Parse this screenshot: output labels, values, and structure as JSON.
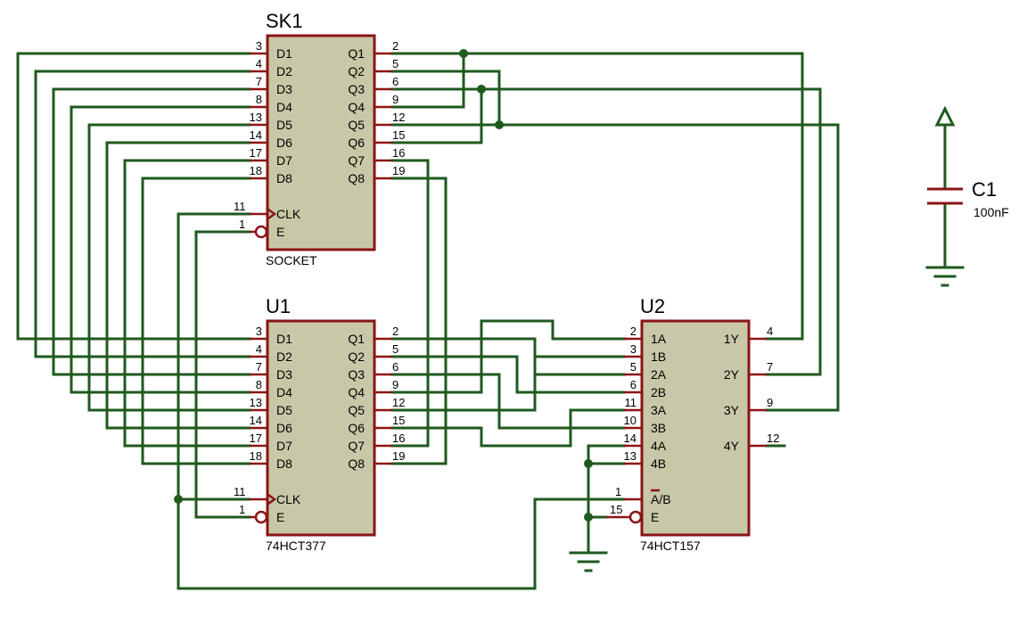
{
  "components": {
    "sk1": {
      "ref": "SK1",
      "value": "SOCKET",
      "left_pins": [
        {
          "num": "3",
          "label": "D1"
        },
        {
          "num": "4",
          "label": "D2"
        },
        {
          "num": "7",
          "label": "D3"
        },
        {
          "num": "8",
          "label": "D4"
        },
        {
          "num": "13",
          "label": "D5"
        },
        {
          "num": "14",
          "label": "D6"
        },
        {
          "num": "17",
          "label": "D7"
        },
        {
          "num": "18",
          "label": "D8"
        }
      ],
      "right_pins": [
        {
          "num": "2",
          "label": "Q1"
        },
        {
          "num": "5",
          "label": "Q2"
        },
        {
          "num": "6",
          "label": "Q3"
        },
        {
          "num": "9",
          "label": "Q4"
        },
        {
          "num": "12",
          "label": "Q5"
        },
        {
          "num": "15",
          "label": "Q6"
        },
        {
          "num": "16",
          "label": "Q7"
        },
        {
          "num": "19",
          "label": "Q8"
        }
      ],
      "clk": {
        "num": "11",
        "label": "CLK"
      },
      "en": {
        "num": "1",
        "label": "E"
      }
    },
    "u1": {
      "ref": "U1",
      "value": "74HCT377",
      "left_pins": [
        {
          "num": "3",
          "label": "D1"
        },
        {
          "num": "4",
          "label": "D2"
        },
        {
          "num": "7",
          "label": "D3"
        },
        {
          "num": "8",
          "label": "D4"
        },
        {
          "num": "13",
          "label": "D5"
        },
        {
          "num": "14",
          "label": "D6"
        },
        {
          "num": "17",
          "label": "D7"
        },
        {
          "num": "18",
          "label": "D8"
        }
      ],
      "right_pins": [
        {
          "num": "2",
          "label": "Q1"
        },
        {
          "num": "5",
          "label": "Q2"
        },
        {
          "num": "6",
          "label": "Q3"
        },
        {
          "num": "9",
          "label": "Q4"
        },
        {
          "num": "12",
          "label": "Q5"
        },
        {
          "num": "15",
          "label": "Q6"
        },
        {
          "num": "16",
          "label": "Q7"
        },
        {
          "num": "19",
          "label": "Q8"
        }
      ],
      "clk": {
        "num": "11",
        "label": "CLK"
      },
      "en": {
        "num": "1",
        "label": "E"
      }
    },
    "u2": {
      "ref": "U2",
      "value": "74HCT157",
      "left_pins": [
        {
          "num": "2",
          "label": "1A"
        },
        {
          "num": "3",
          "label": "1B"
        },
        {
          "num": "5",
          "label": "2A"
        },
        {
          "num": "6",
          "label": "2B"
        },
        {
          "num": "11",
          "label": "3A"
        },
        {
          "num": "10",
          "label": "3B"
        },
        {
          "num": "14",
          "label": "4A"
        },
        {
          "num": "13",
          "label": "4B"
        }
      ],
      "right_pins": [
        {
          "num": "4",
          "label": "1Y"
        },
        {
          "num": "7",
          "label": "2Y"
        },
        {
          "num": "9",
          "label": "3Y"
        },
        {
          "num": "12",
          "label": "4Y"
        }
      ],
      "sel": {
        "num": "1",
        "label": "A/B"
      },
      "en": {
        "num": "15",
        "label": "E"
      }
    },
    "c1": {
      "ref": "C1",
      "value": "100nF"
    }
  },
  "colors": {
    "wire": "#1f5a1f",
    "pin": "#8b1414",
    "body": "#c8c8a8"
  }
}
